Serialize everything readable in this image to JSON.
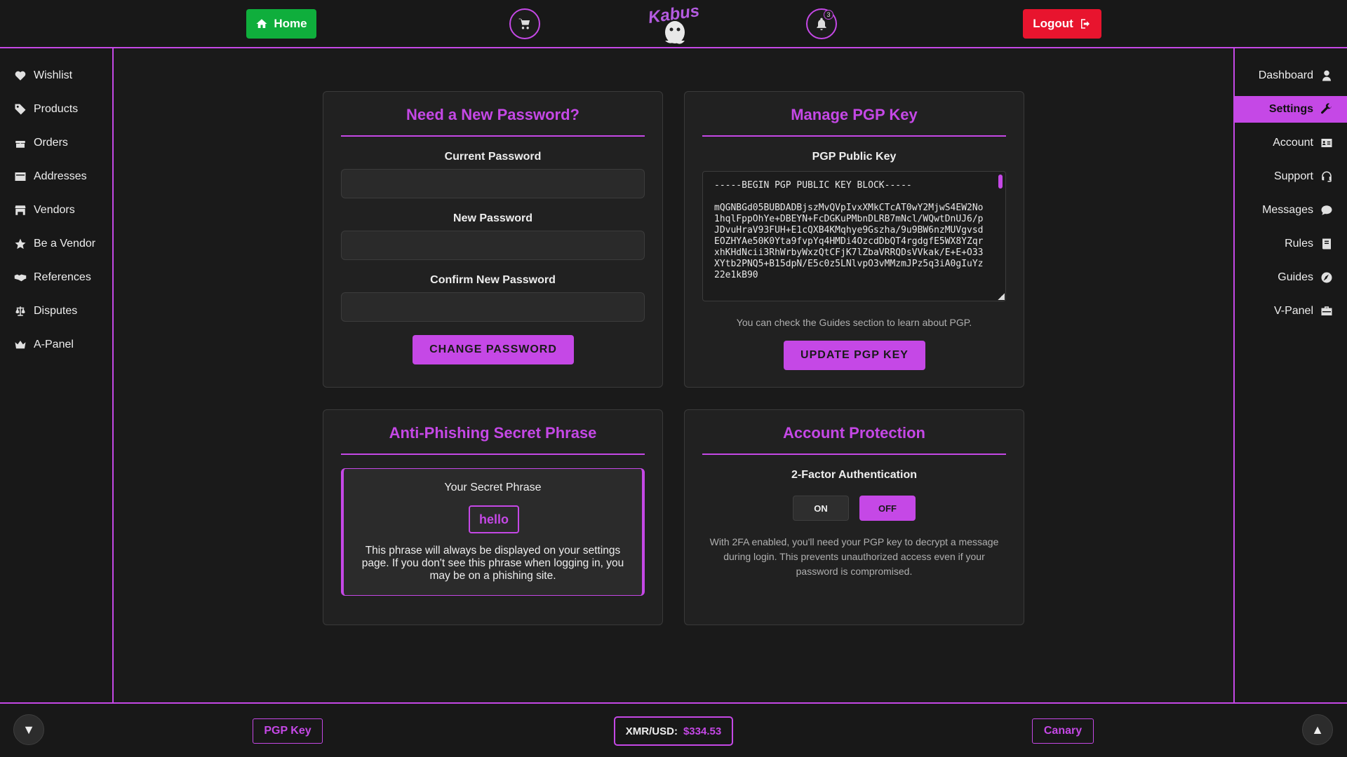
{
  "header": {
    "home_label": "Home",
    "logout_label": "Logout",
    "notification_count": "3",
    "logo_text": "Kabus"
  },
  "sidebar_left": {
    "items": [
      {
        "label": "Wishlist",
        "icon": "heart-icon"
      },
      {
        "label": "Products",
        "icon": "tag-icon"
      },
      {
        "label": "Orders",
        "icon": "gift-icon"
      },
      {
        "label": "Addresses",
        "icon": "address-card-icon"
      },
      {
        "label": "Vendors",
        "icon": "store-icon"
      },
      {
        "label": "Be a Vendor",
        "icon": "star-icon"
      },
      {
        "label": "References",
        "icon": "handshake-icon"
      },
      {
        "label": "Disputes",
        "icon": "scale-icon"
      },
      {
        "label": "A-Panel",
        "icon": "crown-icon"
      }
    ]
  },
  "sidebar_right": {
    "items": [
      {
        "label": "Dashboard",
        "icon": "user-icon"
      },
      {
        "label": "Settings",
        "icon": "wrench-icon",
        "active": true
      },
      {
        "label": "Account",
        "icon": "id-card-icon"
      },
      {
        "label": "Support",
        "icon": "headset-icon"
      },
      {
        "label": "Messages",
        "icon": "chat-bubble-icon"
      },
      {
        "label": "Rules",
        "icon": "book-icon"
      },
      {
        "label": "Guides",
        "icon": "compass-icon"
      },
      {
        "label": "V-Panel",
        "icon": "briefcase-icon"
      }
    ]
  },
  "password_card": {
    "title": "Need a New Password?",
    "current_label": "Current Password",
    "current_value": "",
    "new_label": "New Password",
    "new_value": "",
    "confirm_label": "Confirm New Password",
    "confirm_value": "",
    "button_label": "CHANGE PASSWORD"
  },
  "pgp_card": {
    "title": "Manage PGP Key",
    "field_label": "PGP Public Key",
    "key_header": "-----BEGIN PGP PUBLIC KEY BLOCK-----",
    "key_body": "mQGNBGd05BUBDADBjszMvQVpIvxXMkCTcAT0wY2MjwS4EW2No1hqlFppOhYe+DBEYN+FcDGKuPMbnDLRB7mNcl/WQwtDnUJ6/pJDvuHraV93FUH+E1cQXB4KMqhye9Gszha/9u9BW6nzMUVgvsdEOZHYAe50K0Yta9fvpYq4HMDi4OzcdDbQT4rgdgfE5WX8YZqrxhKHdNcii3RhWrbyWxzQtCFjK7lZbaVRRQDsVVkak/E+E+O33XYtb2PNQ5+B15dpN/E5c0z5LNlvpO3vMMzmJPz5q3iA0gIuYz22e1kB90",
    "hint": "You can check the Guides section to learn about PGP.",
    "button_label": "UPDATE PGP KEY"
  },
  "phishing_card": {
    "title": "Anti-Phishing Secret Phrase",
    "label": "Your Secret Phrase",
    "phrase": "hello",
    "note": "This phrase will always be displayed on your settings page. If you don't see this phrase when logging in, you may be on a phishing site."
  },
  "protection_card": {
    "title": "Account Protection",
    "twofa_label": "2-Factor Authentication",
    "on_label": "ON",
    "off_label": "OFF",
    "selected": "OFF",
    "note": "With 2FA enabled, you'll need your PGP key to decrypt a message during login. This prevents unauthorized access even if your password is compromised."
  },
  "footer": {
    "pgp_key_label": "PGP Key",
    "price_label": "XMR/USD:",
    "price_value": "$334.53",
    "canary_label": "Canary",
    "down_symbol": "▼",
    "up_symbol": "▲"
  },
  "colors": {
    "accent": "#c548e6",
    "home_green": "#0fae3c",
    "logout_red": "#e8142e",
    "background": "#1a1a1a"
  }
}
